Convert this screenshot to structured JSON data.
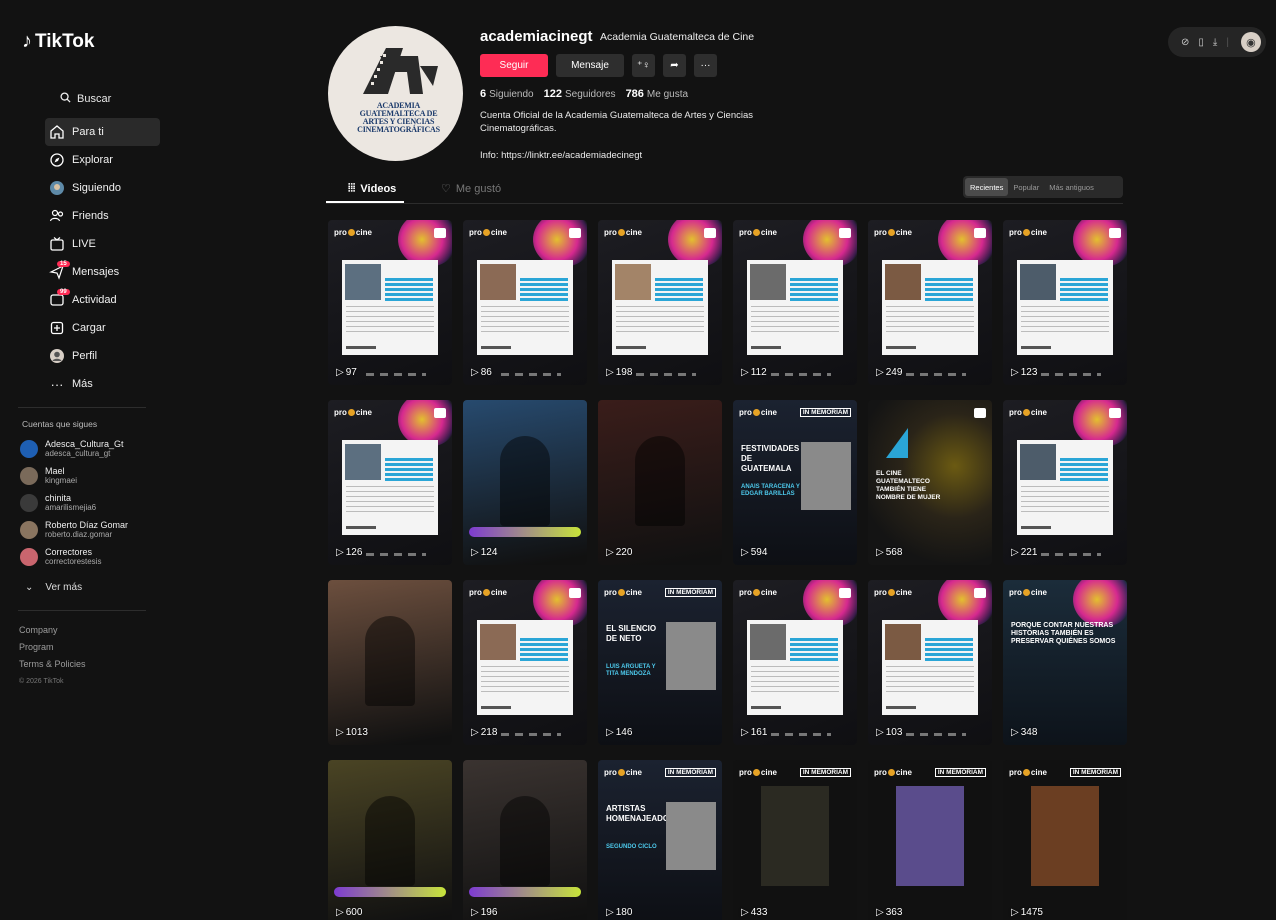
{
  "app": {
    "logo_text": "TikTok",
    "search_label": "Buscar",
    "nav": [
      {
        "label": "Para ti",
        "icon": "home-icon"
      },
      {
        "label": "Explorar",
        "icon": "compass-icon"
      },
      {
        "label": "Siguiendo",
        "icon": "following-avatar-icon"
      },
      {
        "label": "Friends",
        "icon": "friends-icon"
      },
      {
        "label": "LIVE",
        "icon": "live-icon"
      },
      {
        "label": "Mensajes",
        "icon": "messages-icon",
        "badge": "15"
      },
      {
        "label": "Actividad",
        "icon": "activity-icon",
        "badge": "99"
      },
      {
        "label": "Cargar",
        "icon": "upload-icon"
      },
      {
        "label": "Perfil",
        "icon": "profile-icon"
      },
      {
        "label": "Más",
        "icon": "more-icon"
      }
    ],
    "following_title": "Cuentas que sigues",
    "following": [
      {
        "name": "Adesca_Cultura_Gt",
        "user": "adesca_cultura_gt",
        "color": "#1e5fb3"
      },
      {
        "name": "Mael",
        "user": "kingmaei",
        "color": "#7a6a5a"
      },
      {
        "name": "chinita",
        "user": "amarilismejia6",
        "color": "#3a3a3a"
      },
      {
        "name": "Roberto Díaz Gomar",
        "user": "roberto.diaz.gomar",
        "color": "#8a7560"
      },
      {
        "name": "Correctores",
        "user": "correctorestesis",
        "color": "#c9656e"
      }
    ],
    "see_more": "Ver más",
    "footer": [
      "Company",
      "Program",
      "Terms & Policies"
    ],
    "copyright": "© 2026 TikTok"
  },
  "profile": {
    "username": "academiacinegt",
    "display_name": "Academia Guatemalteca de Cine",
    "avatar_text": "ACADEMIA GUATEMALTECA DE ARTES Y CIENCIAS CINEMATOGRÁFICAS",
    "follow_label": "Seguir",
    "message_label": "Mensaje",
    "following_count": "6",
    "following_label": "Siguiendo",
    "followers_count": "122",
    "followers_label": "Seguidores",
    "likes_count": "786",
    "likes_label": "Me gusta",
    "bio": "Cuenta Oficial de la Academia Guatemalteca de Artes y Ciencias Cinematográficas.",
    "info": "Info: https://linktr.ee/academiadecinegt"
  },
  "tabs": {
    "videos": "Videos",
    "liked": "Me gustó"
  },
  "sort": [
    "Recientes",
    "Popular",
    "Más antiguos"
  ],
  "videos": [
    {
      "views": "97",
      "kind": "card"
    },
    {
      "views": "86",
      "kind": "card"
    },
    {
      "views": "198",
      "kind": "card"
    },
    {
      "views": "112",
      "kind": "card"
    },
    {
      "views": "249",
      "kind": "card"
    },
    {
      "views": "123",
      "kind": "card"
    },
    {
      "views": "126",
      "kind": "card"
    },
    {
      "views": "124",
      "kind": "photo",
      "bg": "#274a6e"
    },
    {
      "views": "220",
      "kind": "photo",
      "bg": "#3a1d1a"
    },
    {
      "views": "594",
      "kind": "memoria",
      "title": "FESTIVIDADES DE GUATEMALA",
      "names": "ANAIS TARACENA Y EDGAR BARILLAS"
    },
    {
      "views": "568",
      "kind": "dark",
      "title": "EL CINE GUATEMALTECO TAMBIÉN TIENE NOMBRE DE MUJER"
    },
    {
      "views": "221",
      "kind": "card"
    },
    {
      "views": "1013",
      "kind": "photo",
      "bg": "#6c4f3e"
    },
    {
      "views": "218",
      "kind": "card"
    },
    {
      "views": "146",
      "kind": "memoria",
      "title": "EL SILENCIO DE NETO",
      "names": "LUIS ARGUETA Y TITA MENDOZA"
    },
    {
      "views": "161",
      "kind": "card"
    },
    {
      "views": "103",
      "kind": "card"
    },
    {
      "views": "348",
      "kind": "text",
      "title": "PORQUE CONTAR NUESTRAS HISTORIAS TAMBIÉN ES PRESERVAR QUIÉNES SOMOS"
    },
    {
      "views": "600",
      "kind": "photo",
      "bg": "#4a4424"
    },
    {
      "views": "196",
      "kind": "photo",
      "bg": "#3a3330"
    },
    {
      "views": "180",
      "kind": "memoria",
      "title": "ARTISTAS HOMENAJEADOS",
      "names": "SEGUNDO CICLO"
    },
    {
      "views": "433",
      "kind": "poster",
      "bg": "#2b2a22"
    },
    {
      "views": "363",
      "kind": "poster",
      "bg": "#5a4c8c"
    },
    {
      "views": "1475",
      "kind": "poster",
      "bg": "#6b3e22"
    }
  ],
  "colors": {
    "accent": "#fe2c55",
    "background": "#121212"
  }
}
